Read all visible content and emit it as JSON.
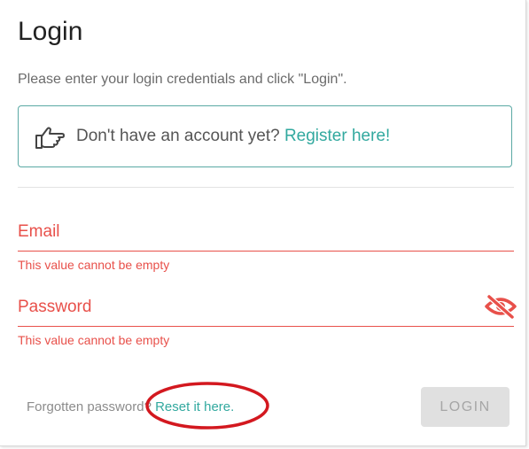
{
  "dialog": {
    "title": "Login",
    "subtitle": "Please enter your login credentials and click \"Login\"."
  },
  "register": {
    "prompt": "Don't have an account yet?",
    "link": "Register here!",
    "icon": "thumb-pointing-right-icon"
  },
  "email": {
    "label": "Email",
    "value": "",
    "error": "This value cannot be empty"
  },
  "password": {
    "label": "Password",
    "value": "",
    "error": "This value cannot be empty",
    "toggle_icon": "eye-slash-icon"
  },
  "footer": {
    "forgot_text": "Forgotten password?",
    "reset_link": "Reset it here.",
    "login_label": "LOGIN"
  },
  "colors": {
    "accent": "#32a99f",
    "error": "#e8504a",
    "annotation": "#d3181f",
    "button_disabled": "#e0e0e0"
  }
}
